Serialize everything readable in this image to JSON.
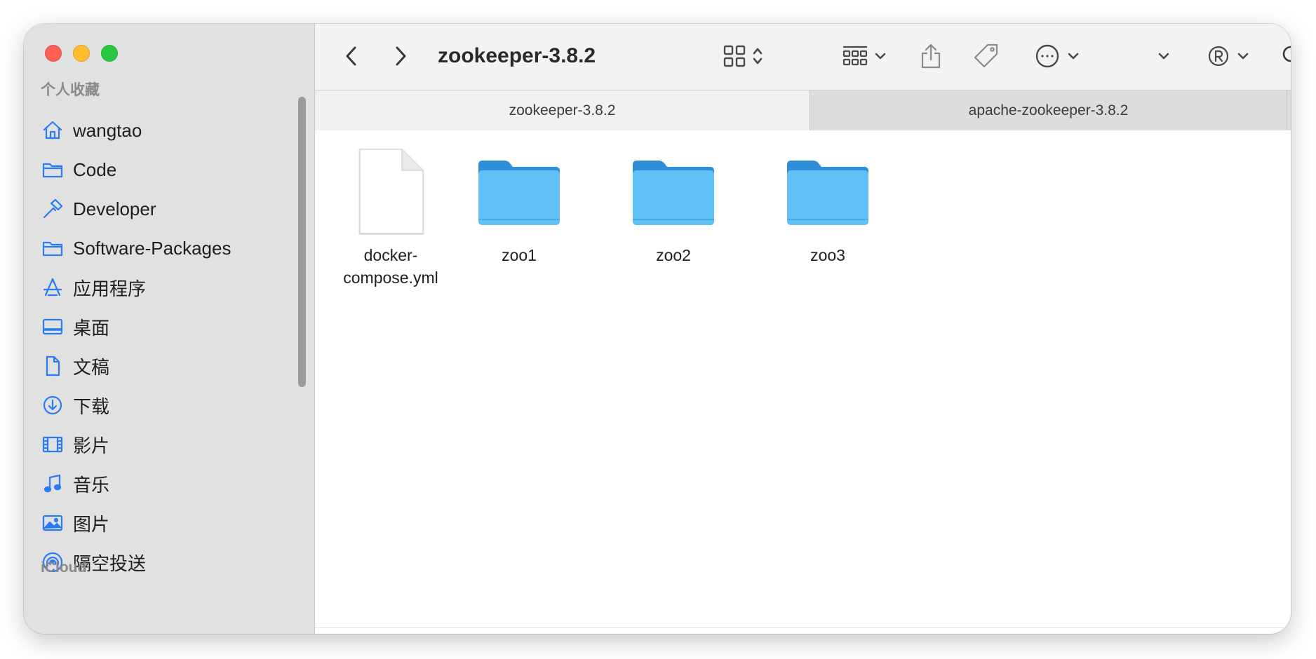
{
  "sidebar": {
    "favorites_label": "个人收藏",
    "items": [
      {
        "label": "wangtao",
        "icon": "home-icon"
      },
      {
        "label": "Code",
        "icon": "folder-icon"
      },
      {
        "label": "Developer",
        "icon": "hammer-icon"
      },
      {
        "label": "Software-Packages",
        "icon": "folder-icon"
      },
      {
        "label": "应用程序",
        "icon": "applications-icon"
      },
      {
        "label": "桌面",
        "icon": "desktop-icon"
      },
      {
        "label": "文稿",
        "icon": "document-icon"
      },
      {
        "label": "下载",
        "icon": "download-icon"
      },
      {
        "label": "影片",
        "icon": "film-icon"
      },
      {
        "label": "音乐",
        "icon": "music-icon"
      },
      {
        "label": "图片",
        "icon": "photo-icon"
      },
      {
        "label": "隔空投送",
        "icon": "airdrop-icon"
      }
    ],
    "icloud_label": "iCloud"
  },
  "toolbar": {
    "title": "zookeeper-3.8.2"
  },
  "tabs": [
    {
      "label": "zookeeper-3.8.2",
      "active": true
    },
    {
      "label": "apache-zookeeper-3.8.2",
      "active": false
    }
  ],
  "files": [
    {
      "name": "docker-compose.yml",
      "type": "document-file-icon"
    },
    {
      "name": "zoo1",
      "type": "folder-icon"
    },
    {
      "name": "zoo2",
      "type": "folder-icon"
    },
    {
      "name": "zoo3",
      "type": "folder-icon"
    }
  ],
  "colors": {
    "accent": "#2a7cf6",
    "folder": "#5fbff5",
    "sidebar_bg": "#e1e1e1"
  }
}
